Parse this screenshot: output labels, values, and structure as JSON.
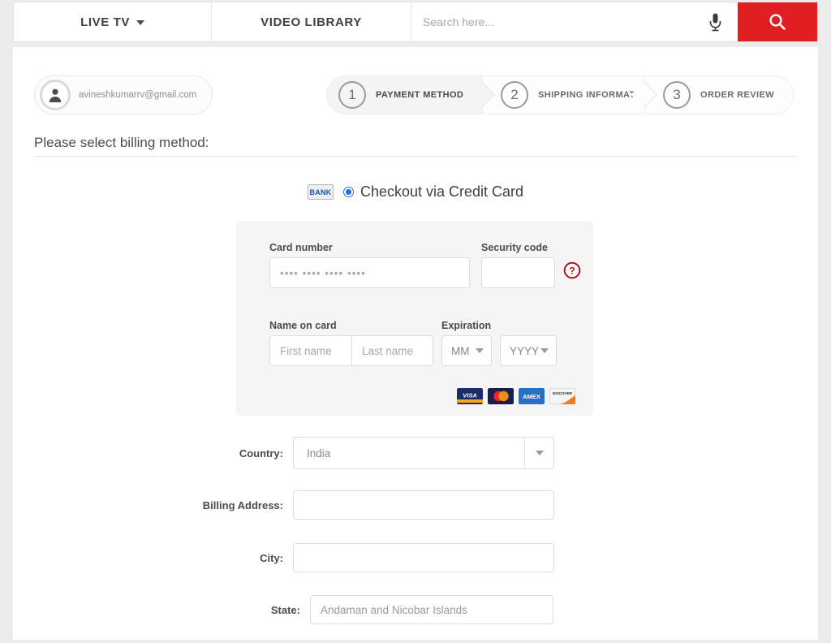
{
  "topnav": {
    "live_tv": "LIVE TV",
    "video_library": "VIDEO LIBRARY",
    "search_placeholder": "Search here...",
    "search_value": "",
    "mic_icon": "microphone-icon",
    "search_icon": "search-icon",
    "accent_color": "#e11f22"
  },
  "account": {
    "email": "avineshkumarrv@gmail.com",
    "avatar_icon": "user-avatar-icon"
  },
  "steps": [
    {
      "number": "1",
      "label": "PAYMENT METHOD",
      "active": true
    },
    {
      "number": "2",
      "label": "SHIPPING INFORMATION",
      "active": false
    },
    {
      "number": "3",
      "label": "ORDER REVIEW",
      "active": false
    }
  ],
  "billing": {
    "heading": "Please select billing method:",
    "option_label": "Checkout via Credit Card",
    "bank_badge": "BANK",
    "option_selected": true
  },
  "card_form": {
    "card_number_label": "Card number",
    "card_number_placeholder": "•••• •••• •••• ••••",
    "card_number_value": "",
    "security_code_label": "Security code",
    "security_code_value": "",
    "security_code_placeholder": "",
    "help_icon": "question-mark-circle-icon",
    "name_label": "Name on card",
    "first_name_placeholder": "First name",
    "first_name_value": "",
    "last_name_placeholder": "Last name",
    "last_name_value": "",
    "expiration_label": "Expiration",
    "month_value": "MM",
    "year_value": "YYYY",
    "brands": [
      "VISA",
      "MasterCard",
      "AMEX",
      "DISCOVER"
    ]
  },
  "address": {
    "country_label": "Country:",
    "country_value": "India",
    "billing_address_label": "Billing Address:",
    "billing_address_value": "",
    "billing_address_placeholder": "",
    "city_label": "City:",
    "city_value": "",
    "city_placeholder": "",
    "state_label": "State:",
    "state_value": "Andaman and Nicobar Islands"
  }
}
